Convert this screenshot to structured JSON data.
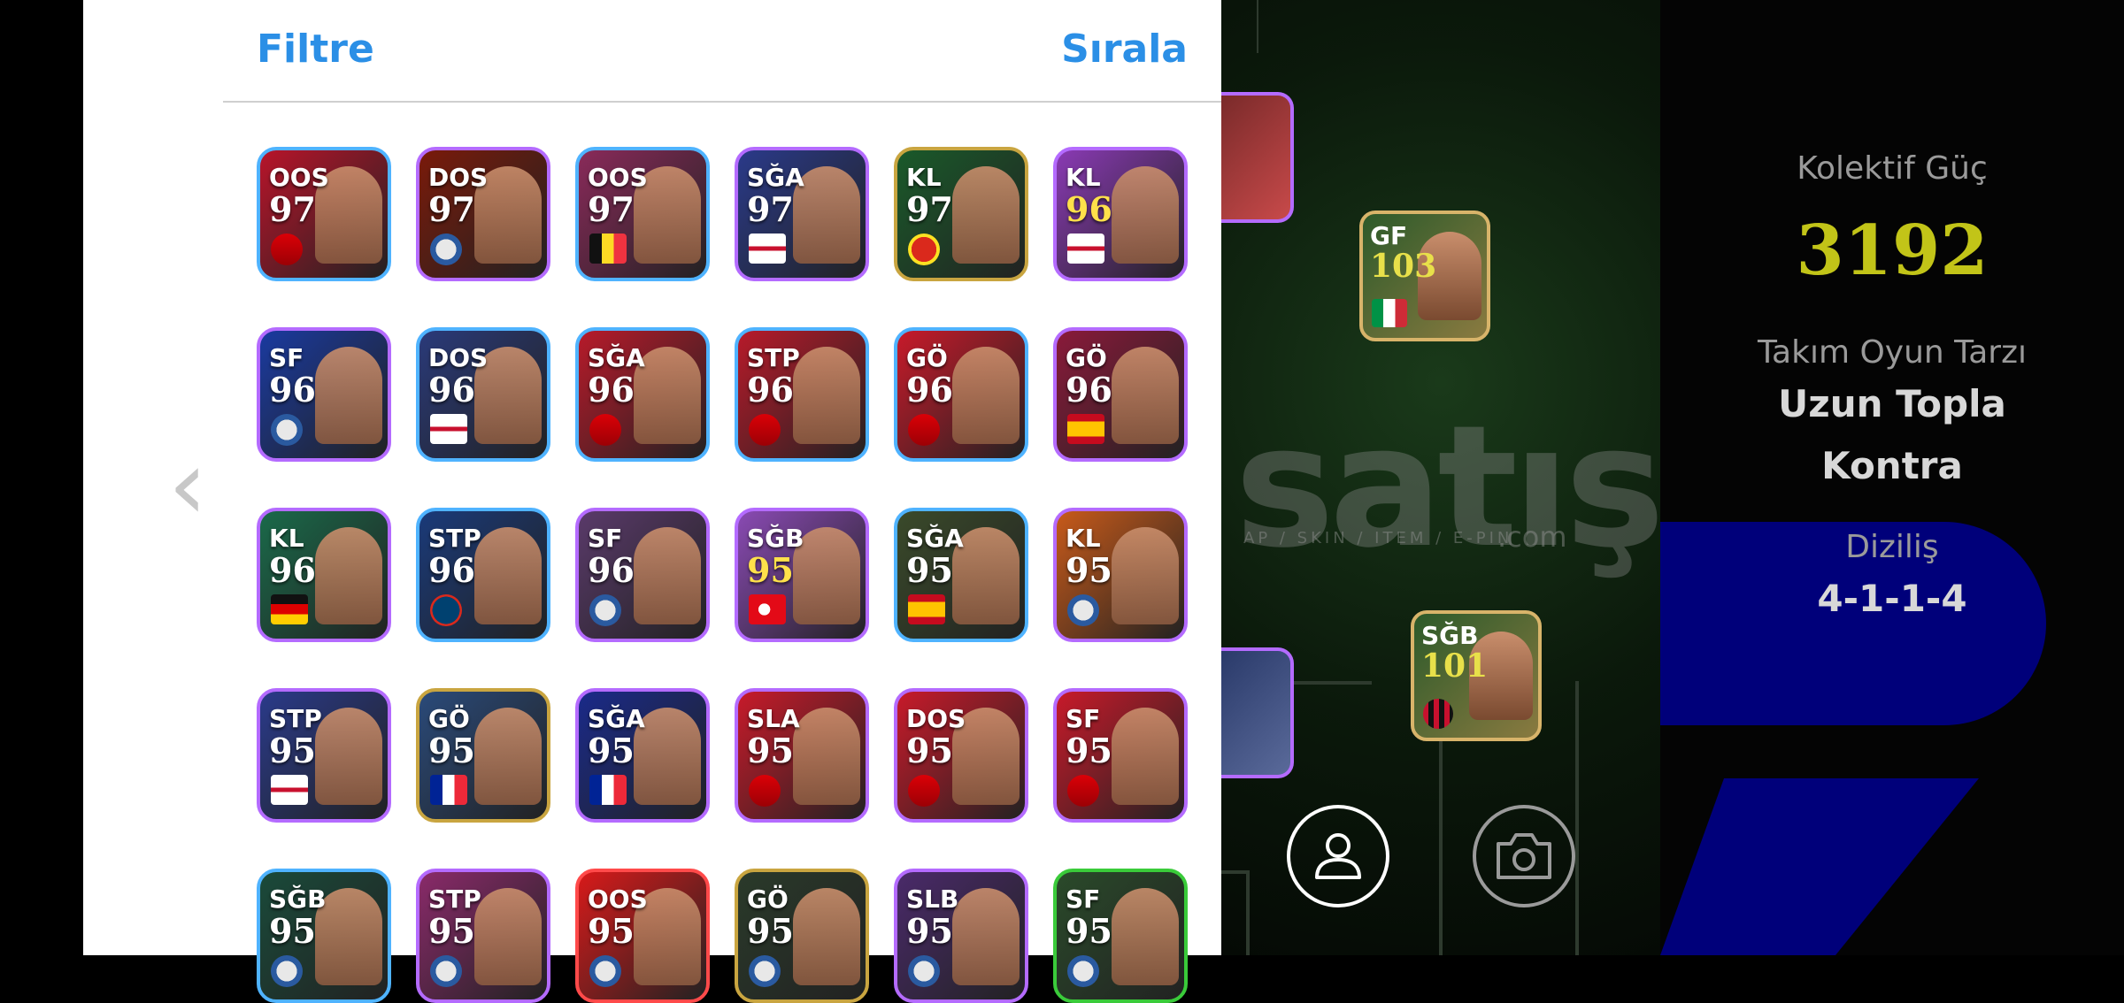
{
  "panel": {
    "filter_label": "Filtre",
    "sort_label": "Sırala"
  },
  "players": [
    {
      "pos": "OOS",
      "rating": "97",
      "gold": false,
      "frame": "#4fb3ff",
      "bg": "#b8142a",
      "badge": "arsenal-crest"
    },
    {
      "pos": "DOS",
      "rating": "97",
      "gold": false,
      "frame": "#b46bff",
      "bg": "#7a1a0a",
      "badge": "club-crest"
    },
    {
      "pos": "OOS",
      "rating": "97",
      "gold": false,
      "frame": "#4fb3ff",
      "bg": "#8a2a5a",
      "badge": "belgium-flag"
    },
    {
      "pos": "SĞA",
      "rating": "97",
      "gold": false,
      "frame": "#b46bff",
      "bg": "#2a3a8a",
      "badge": "england-flag"
    },
    {
      "pos": "KL",
      "rating": "97",
      "gold": false,
      "frame": "#c9a540",
      "bg": "#1a5a2a",
      "badge": "manutd-crest"
    },
    {
      "pos": "KL",
      "rating": "96",
      "gold": true,
      "frame": "#b46bff",
      "bg": "#8a3ab4",
      "badge": "england-flag"
    },
    {
      "pos": "SF",
      "rating": "96",
      "gold": false,
      "frame": "#b46bff",
      "bg": "#1a3aa0",
      "badge": "club-crest"
    },
    {
      "pos": "DOS",
      "rating": "96",
      "gold": false,
      "frame": "#4fb3ff",
      "bg": "#2a3a7a",
      "badge": "england-flag"
    },
    {
      "pos": "SĞA",
      "rating": "96",
      "gold": false,
      "frame": "#4fb3ff",
      "bg": "#b81a2a",
      "badge": "arsenal-crest"
    },
    {
      "pos": "STP",
      "rating": "96",
      "gold": false,
      "frame": "#4fb3ff",
      "bg": "#b81a2a",
      "badge": "arsenal-crest"
    },
    {
      "pos": "GÖ",
      "rating": "96",
      "gold": false,
      "frame": "#4fb3ff",
      "bg": "#c81a2a",
      "badge": "arsenal-crest"
    },
    {
      "pos": "GÖ",
      "rating": "96",
      "gold": false,
      "frame": "#b46bff",
      "bg": "#8a1a3a",
      "badge": "spain-flag"
    },
    {
      "pos": "KL",
      "rating": "96",
      "gold": false,
      "frame": "#b46bff",
      "bg": "#1a6a4a",
      "badge": "germany-flag"
    },
    {
      "pos": "STP",
      "rating": "96",
      "gold": false,
      "frame": "#4fb3ff",
      "bg": "#1a3a7a",
      "badge": "psg-crest"
    },
    {
      "pos": "SF",
      "rating": "96",
      "gold": false,
      "frame": "#b46bff",
      "bg": "#5a3a6a",
      "badge": "club-crest"
    },
    {
      "pos": "SĞB",
      "rating": "95",
      "gold": true,
      "frame": "#b46bff",
      "bg": "#8a4ab4",
      "badge": "turkey-flag"
    },
    {
      "pos": "SĞA",
      "rating": "95",
      "gold": false,
      "frame": "#4fb3ff",
      "bg": "#3a4a2a",
      "badge": "spain-flag"
    },
    {
      "pos": "KL",
      "rating": "95",
      "gold": false,
      "frame": "#b46bff",
      "bg": "#c85a1a",
      "badge": "club-crest"
    },
    {
      "pos": "STP",
      "rating": "95",
      "gold": false,
      "frame": "#b46bff",
      "bg": "#2a3a8a",
      "badge": "england-flag"
    },
    {
      "pos": "GÖ",
      "rating": "95",
      "gold": false,
      "frame": "#c9a540",
      "bg": "#2a4a7a",
      "badge": "france-flag"
    },
    {
      "pos": "SĞA",
      "rating": "95",
      "gold": false,
      "frame": "#b46bff",
      "bg": "#1a2a8a",
      "badge": "france-flag"
    },
    {
      "pos": "SLA",
      "rating": "95",
      "gold": false,
      "frame": "#b46bff",
      "bg": "#c81a2a",
      "badge": "arsenal-crest"
    },
    {
      "pos": "DOS",
      "rating": "95",
      "gold": false,
      "frame": "#b46bff",
      "bg": "#c81a2a",
      "badge": "arsenal-crest"
    },
    {
      "pos": "SF",
      "rating": "95",
      "gold": false,
      "frame": "#b46bff",
      "bg": "#c81a2a",
      "badge": "arsenal-crest"
    },
    {
      "pos": "SĞB",
      "rating": "95",
      "gold": false,
      "frame": "#4fb3ff",
      "bg": "#1a4a3a",
      "badge": "club-crest"
    },
    {
      "pos": "STP",
      "rating": "95",
      "gold": false,
      "frame": "#b46bff",
      "bg": "#8a2a6a",
      "badge": "club-crest"
    },
    {
      "pos": "OOS",
      "rating": "95",
      "gold": false,
      "frame": "#ff4a4a",
      "bg": "#d81a1a",
      "badge": "club-crest"
    },
    {
      "pos": "GÖ",
      "rating": "95",
      "gold": false,
      "frame": "#c9a540",
      "bg": "#2a3a2a",
      "badge": "club-crest"
    },
    {
      "pos": "SLB",
      "rating": "95",
      "gold": false,
      "frame": "#b46bff",
      "bg": "#4a2a6a",
      "badge": "club-crest"
    },
    {
      "pos": "SF",
      "rating": "95",
      "gold": false,
      "frame": "#3acb3a",
      "bg": "#2a4a2a",
      "badge": "club-crest"
    }
  ],
  "field_cards": [
    {
      "pos": "GF",
      "rating": "103",
      "badge": "italy-flag"
    },
    {
      "pos": "SĞB",
      "rating": "101",
      "badge": "acmilan-crest"
    }
  ],
  "stats": {
    "power_label": "Kolektif Güç",
    "power_value": "3192",
    "style_label": "Takım Oyun Tarzı",
    "style_line1": "Uzun Topla",
    "style_line2": "Kontra",
    "formation_label": "Diziliş",
    "formation_value": "4-1-1-4"
  },
  "watermark": {
    "text": "satış",
    "sub": "AP / SKIN / ITEM / E-PIN",
    "com": ".com"
  },
  "colors": {
    "accent": "#2b8fe6",
    "power": "#c2c418",
    "blue_panel": "#00007a"
  }
}
